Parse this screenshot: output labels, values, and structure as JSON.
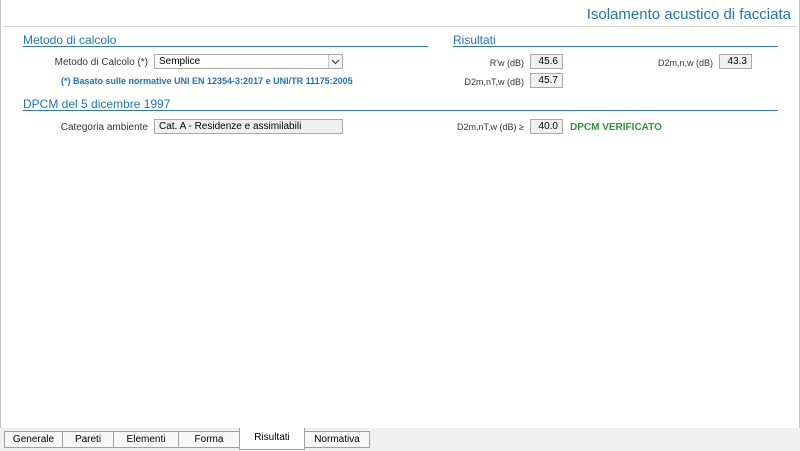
{
  "header": {
    "title": "Isolamento acustico di facciata"
  },
  "metodo": {
    "section_title": "Metodo di calcolo",
    "calc_label": "Metodo di Calcolo (*)",
    "calc_value": "Semplice",
    "note": "(*) Basato sulle normative UNI EN 12354-3:2017 e UNI/TR 11175:2005"
  },
  "risultati": {
    "section_title": "Risultati",
    "rw_label": "R'w (dB)",
    "rw_value": "45.6",
    "d2mnw_label": "D2m,n,w (dB)",
    "d2mnw_value": "43.3",
    "d2mntw_label": "D2m,nT,w (dB)",
    "d2mntw_value": "45.7"
  },
  "dpcm": {
    "section_title": "DPCM del 5 dicembre 1997",
    "categoria_label": "Categoria ambiente",
    "categoria_value": "Cat. A - Residenze e assimilabili",
    "limit_label": "D2m,nT,w (dB) ≥",
    "limit_value": "40.0",
    "status": "DPCM VERIFICATO",
    "status_color": "#2e9a2e"
  },
  "tabs": [
    {
      "label": "Generale"
    },
    {
      "label": "Pareti"
    },
    {
      "label": "Elementi"
    },
    {
      "label": "Forma"
    },
    {
      "label": "Risultati",
      "active": true
    },
    {
      "label": "Normativa"
    }
  ],
  "colors": {
    "accent": "#1e73be",
    "verified": "#2e9a2e"
  }
}
